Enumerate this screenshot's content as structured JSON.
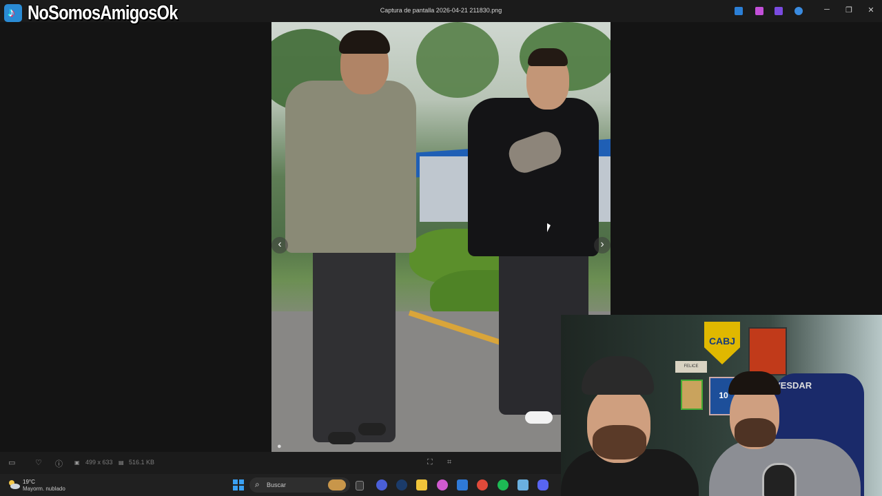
{
  "window": {
    "title": "Captura de pantalla 2026-04-21 211830.png",
    "watermark": "NoSomosAmigosOk",
    "controls": {
      "minimize": "─",
      "restore": "❐",
      "close": "✕"
    }
  },
  "viewer": {
    "prev_arrow": "‹",
    "next_arrow": "›"
  },
  "statusbar": {
    "dimensions": "499 x 633",
    "filesize": "516.1 KB"
  },
  "taskbar": {
    "weather": {
      "temp": "19°C",
      "condition": "Mayorm. nublado"
    },
    "search_placeholder": "Buscar"
  },
  "webcam": {
    "badge": "CABJ",
    "chair_brand": "VESDAR",
    "plate": "FELICE SEGUILO",
    "frame_number": "10"
  },
  "colors": {
    "tiktok": "#2a8bd4",
    "windows_accent": "#3aa0f3",
    "boca_gold": "#e0b800",
    "boca_blue": "#163a7a"
  },
  "icons": [
    "tiktok-icon",
    "tray-edit-icon",
    "tray-pen-icon",
    "tray-video-icon",
    "tray-cloud-icon",
    "filmstrip-icon",
    "heart-icon",
    "info-icon",
    "dimensions-icon",
    "filesize-icon",
    "fit-icon",
    "crop-icon",
    "user-icon",
    "weather-icon",
    "windows-start-icon",
    "search-icon",
    "task-view-icon",
    "zoom-icon",
    "steam-icon",
    "explorer-icon",
    "copilot-icon",
    "store-icon",
    "chrome-icon",
    "spotify-icon",
    "photos-icon",
    "discord-icon"
  ]
}
